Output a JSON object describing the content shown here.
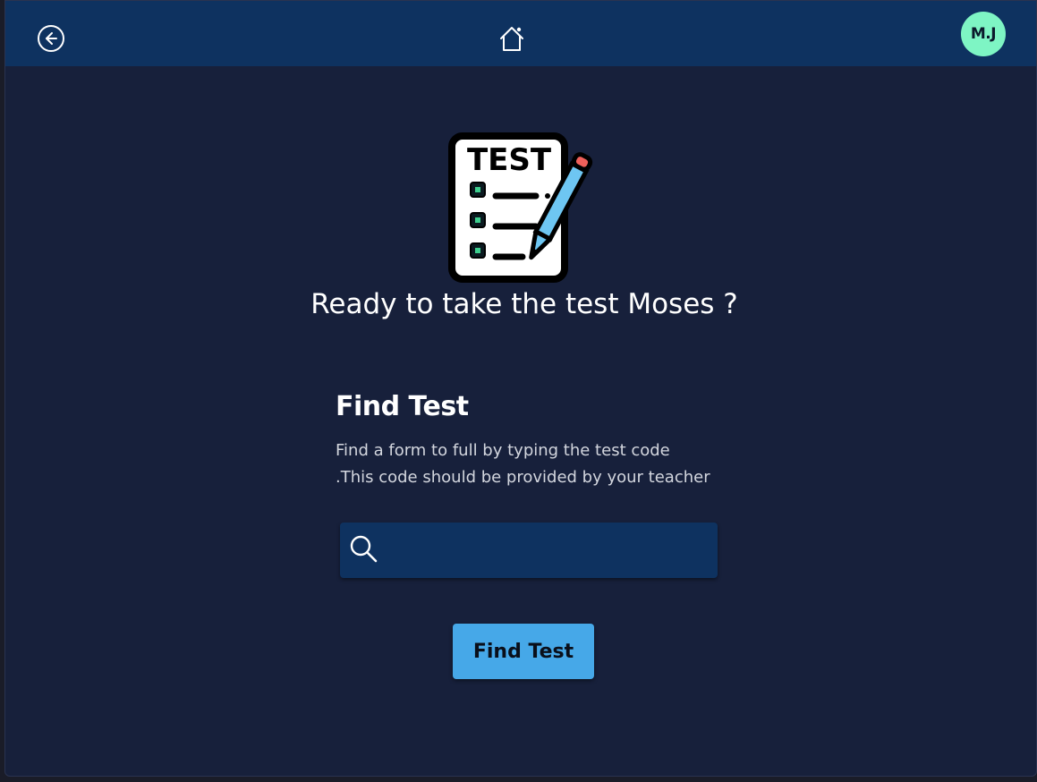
{
  "header": {
    "avatar_initials": "M.J"
  },
  "illustration": {
    "sheet_label": "TEST"
  },
  "main": {
    "headline": "Ready to take the test Moses ?",
    "find_title": "Find Test",
    "description_line1": "Find a form to full by typing the test code",
    "description_line2": ".This code should be provided by your teacher",
    "search": {
      "value": "",
      "placeholder": ""
    },
    "find_button_label": "Find Test"
  },
  "colors": {
    "background": "#17203b",
    "topbar": "#0e3260",
    "avatar": "#7ef5c4",
    "button": "#46a8e8",
    "checkbox_accent": "#3ecf8e",
    "pencil": "#6ec6f2",
    "pencil_eraser": "#f0605a"
  },
  "icons": {
    "back": "arrow-left-circle-icon",
    "home": "home-icon",
    "search": "search-icon",
    "illustration": "test-sheet-pencil-icon"
  }
}
